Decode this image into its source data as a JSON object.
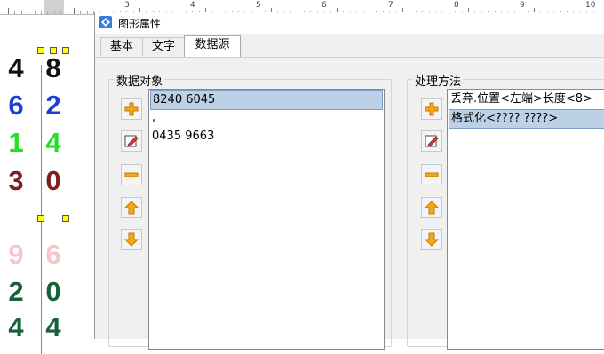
{
  "ruler": {
    "numbers": [
      "3",
      "4",
      "5",
      "6",
      "7",
      "8",
      "9",
      "10"
    ]
  },
  "canvas": {
    "rows": [
      {
        "left": "4",
        "right": "8",
        "left_color": "#111111",
        "right_color": "#111111"
      },
      {
        "left": "6",
        "right": "2",
        "left_color": "#1a3fd6",
        "right_color": "#1a3fd6"
      },
      {
        "left": "1",
        "right": "4",
        "left_color": "#22e022",
        "right_color": "#22e022"
      },
      {
        "left": "3",
        "right": "0",
        "left_color": "#7a2020",
        "right_color": "#7a2020"
      },
      {
        "left": "9",
        "right": "6",
        "left_color": "#f7c6cc",
        "right_color": "#f7c6cc"
      },
      {
        "left": "2",
        "right": "0",
        "left_color": "#16603a",
        "right_color": "#16603a"
      },
      {
        "left": "4",
        "right": "4",
        "left_color": "#16603a",
        "right_color": "#16603a"
      }
    ]
  },
  "dialog": {
    "title": "图形属性",
    "icon": "properties-app-icon",
    "tabs": [
      {
        "label": "基本",
        "active": false
      },
      {
        "label": "文字",
        "active": false
      },
      {
        "label": "数据源",
        "active": true
      }
    ],
    "data_objects": {
      "title": "数据对象",
      "items": [
        {
          "text": "8240 6045",
          "selected": true
        },
        {
          "text": ",",
          "selected": false
        },
        {
          "text": "0435 9663",
          "selected": false
        }
      ]
    },
    "processing": {
      "title": "处理方法",
      "items": [
        {
          "text": "丢弃.位置<左端>长度<8>",
          "selected": false
        },
        {
          "text": "格式化<???? ????>",
          "selected": true
        }
      ]
    },
    "buttons": [
      "add-icon",
      "edit-icon",
      "remove-icon",
      "move-up-icon",
      "move-down-icon"
    ]
  }
}
